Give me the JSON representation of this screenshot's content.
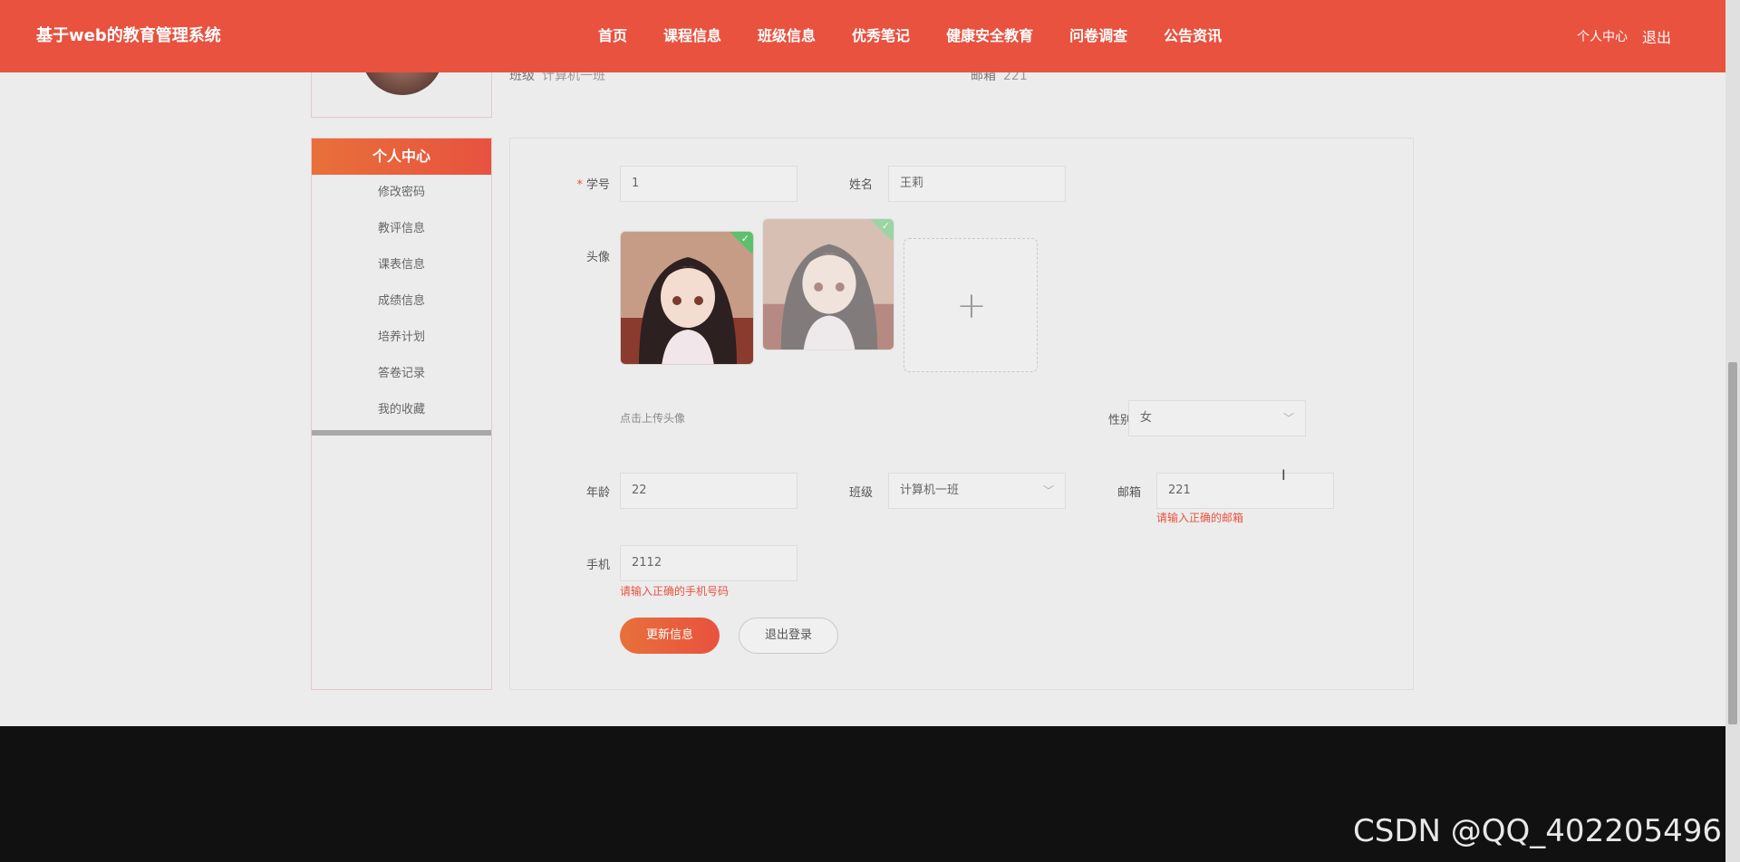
{
  "header": {
    "brand": "基于web的教育管理系统",
    "nav": [
      "首页",
      "课程信息",
      "班级信息",
      "优秀笔记",
      "健康安全教育",
      "问卷调查",
      "公告资讯"
    ],
    "personal_center": "个人中心",
    "logout": "退出"
  },
  "profile_info": {
    "class_label": "班级",
    "class_value": "计算机一班",
    "email_label": "邮箱",
    "email_value": "221"
  },
  "sidebar": {
    "title": "个人中心",
    "items": [
      "修改密码",
      "教评信息",
      "课表信息",
      "成绩信息",
      "培养计划",
      "答卷记录",
      "我的收藏"
    ]
  },
  "form": {
    "student_id_label": "学号",
    "student_id_value": "1",
    "name_label": "姓名",
    "name_value": "王莉",
    "avatar_label": "头像",
    "upload_hint": "点击上传头像",
    "gender_label": "性别",
    "gender_value": "女",
    "age_label": "年龄",
    "age_value": "22",
    "class_label": "班级",
    "class_value": "计算机一班",
    "email_label": "邮箱",
    "email_value": "221",
    "email_error": "请输入正确的邮箱",
    "phone_label": "手机",
    "phone_value": "2112",
    "phone_error": "请输入正确的手机号码",
    "update_button": "更新信息",
    "logout_button": "退出登录"
  },
  "watermark": "CSDN @QQ_402205496",
  "colors": {
    "accent": "#e8523f",
    "accent_gradient_start": "#e8703a",
    "success": "#5bc26b",
    "footer": "#111111"
  }
}
